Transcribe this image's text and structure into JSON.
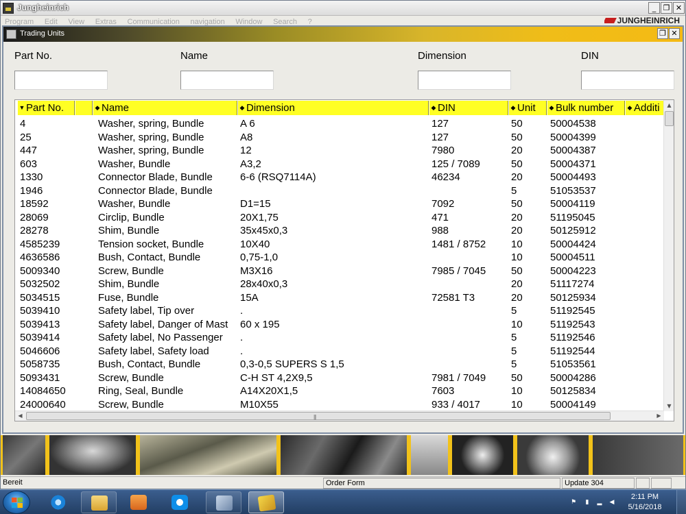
{
  "app": {
    "title": "Jungheinrich",
    "brand": "JUNGHEINRICH",
    "menu": [
      "Program",
      "Edit",
      "View",
      "Extras",
      "Communication",
      "navigation",
      "Window",
      "Search",
      "?"
    ],
    "window_buttons": {
      "minimize": "_",
      "restore": "❐",
      "close": "✕"
    }
  },
  "trading_window": {
    "title": "Trading Units",
    "window_buttons": {
      "restore": "❐",
      "close": "✕"
    },
    "filters": [
      {
        "label": "Part No.",
        "value": ""
      },
      {
        "label": "Name",
        "value": ""
      },
      {
        "label": "Dimension",
        "value": ""
      },
      {
        "label": "DIN",
        "value": ""
      }
    ],
    "columns": [
      {
        "label": "Part No.",
        "sort_icon": "▼"
      },
      {
        "label": "",
        "sort_icon": ""
      },
      {
        "label": "Name",
        "sort_icon": "◆"
      },
      {
        "label": "Dimension",
        "sort_icon": "◆"
      },
      {
        "label": "DIN",
        "sort_icon": "◆"
      },
      {
        "label": "Unit",
        "sort_icon": "◆"
      },
      {
        "label": "Bulk number",
        "sort_icon": "◆"
      },
      {
        "label": "Additi",
        "sort_icon": "◆"
      }
    ],
    "rows": [
      {
        "part": "4",
        "img": true,
        "name": "Washer, spring, Bundle",
        "dim": "A 6",
        "din": "127",
        "unit": "50",
        "bulk": "50004538"
      },
      {
        "part": "25",
        "img": true,
        "name": "Washer, spring, Bundle",
        "dim": "A8",
        "din": "127",
        "unit": "50",
        "bulk": "50004399"
      },
      {
        "part": "447",
        "img": true,
        "name": "Washer, spring, Bundle",
        "dim": "12",
        "din": "7980",
        "unit": "20",
        "bulk": "50004387"
      },
      {
        "part": "603",
        "img": true,
        "name": "Washer, Bundle",
        "dim": "A3,2",
        "din": "125 / 7089",
        "unit": "50",
        "bulk": "50004371"
      },
      {
        "part": "1330",
        "img": true,
        "name": "Connector Blade, Bundle",
        "dim": "6-6 (RSQ7114A)",
        "din": "46234",
        "unit": "20",
        "bulk": "50004493"
      },
      {
        "part": "1946",
        "img": true,
        "name": "Connector Blade, Bundle",
        "dim": "",
        "din": "",
        "unit": "5",
        "bulk": "51053537"
      },
      {
        "part": "18592",
        "img": false,
        "name": "Washer, Bundle",
        "dim": "D1=15",
        "din": "7092",
        "unit": "50",
        "bulk": "50004119"
      },
      {
        "part": "28069",
        "img": false,
        "name": "Circlip, Bundle",
        "dim": "20X1,75",
        "din": "471",
        "unit": "20",
        "bulk": "51195045"
      },
      {
        "part": "28278",
        "img": true,
        "name": "Shim, Bundle",
        "dim": "35x45x0,3",
        "din": "988",
        "unit": "20",
        "bulk": "50125912"
      },
      {
        "part": "4585239",
        "img": true,
        "name": "Tension socket, Bundle",
        "dim": "10X40",
        "din": "1481 / 8752",
        "unit": "10",
        "bulk": "50004424"
      },
      {
        "part": "4636586",
        "img": true,
        "name": "Bush, Contact, Bundle",
        "dim": "0,75-1,0",
        "din": "",
        "unit": "10",
        "bulk": "50004511"
      },
      {
        "part": "5009340",
        "img": true,
        "name": "Screw, Bundle",
        "dim": "M3X16",
        "din": "7985 / 7045",
        "unit": "50",
        "bulk": "50004223"
      },
      {
        "part": "5032502",
        "img": true,
        "name": "Shim, Bundle",
        "dim": "28x40x0,3",
        "din": "",
        "unit": "20",
        "bulk": "51117274"
      },
      {
        "part": "5034515",
        "img": true,
        "name": "Fuse, Bundle",
        "dim": "15A",
        "din": "72581 T3",
        "unit": "20",
        "bulk": "50125934"
      },
      {
        "part": "5039410",
        "img": false,
        "name": "Safety label, Tip over",
        "dim": ".",
        "din": "",
        "unit": "5",
        "bulk": "51192545"
      },
      {
        "part": "5039413",
        "img": false,
        "name": "Safety label, Danger of Mast",
        "dim": "60 x 195",
        "din": "",
        "unit": "10",
        "bulk": "51192543"
      },
      {
        "part": "5039414",
        "img": false,
        "name": "Safety label, No Passenger",
        "dim": ".",
        "din": "",
        "unit": "5",
        "bulk": "51192546"
      },
      {
        "part": "5046606",
        "img": false,
        "name": "Safety label, Safety load",
        "dim": ".",
        "din": "",
        "unit": "5",
        "bulk": "51192544"
      },
      {
        "part": "5058735",
        "img": false,
        "name": "Bush, Contact, Bundle",
        "dim": "0,3-0,5 SUPERS S 1,5",
        "din": "",
        "unit": "5",
        "bulk": "51053561"
      },
      {
        "part": "5093431",
        "img": true,
        "name": "Screw, Bundle",
        "dim": "C-H ST 4,2X9,5",
        "din": "7981 / 7049",
        "unit": "50",
        "bulk": "50004286"
      },
      {
        "part": "14084650",
        "img": true,
        "name": "Ring, Seal, Bundle",
        "dim": "A14X20X1,5",
        "din": "7603",
        "unit": "10",
        "bulk": "50125834"
      },
      {
        "part": "24000640",
        "img": true,
        "name": "Screw, Bundle",
        "dim": "M10X55",
        "din": "933 / 4017",
        "unit": "10",
        "bulk": "50004149"
      }
    ],
    "row_image_icon": "camera-icon",
    "scroll_arrows": {
      "up": "▲",
      "down": "▼",
      "left": "◀",
      "right": "▶"
    },
    "scroll_grip": "|||"
  },
  "status_bar": {
    "left": "Bereit",
    "middle": "Order Form",
    "right": "Update 304"
  },
  "taskbar": {
    "pinned": [
      "internet-explorer-icon",
      "file-explorer-icon",
      "media-player-icon",
      "teamviewer-icon",
      "network-app-icon",
      "jet-app-icon"
    ],
    "clock_time": "2:11 PM",
    "clock_date": "5/16/2018",
    "tray_icons": [
      "notification-flag-icon",
      "power-icon",
      "signal-icon",
      "volume-icon"
    ]
  },
  "colors": {
    "header_yellow": "#ffff24",
    "accent_gold": "#f2c21a",
    "brand_red": "#c61e1e"
  }
}
